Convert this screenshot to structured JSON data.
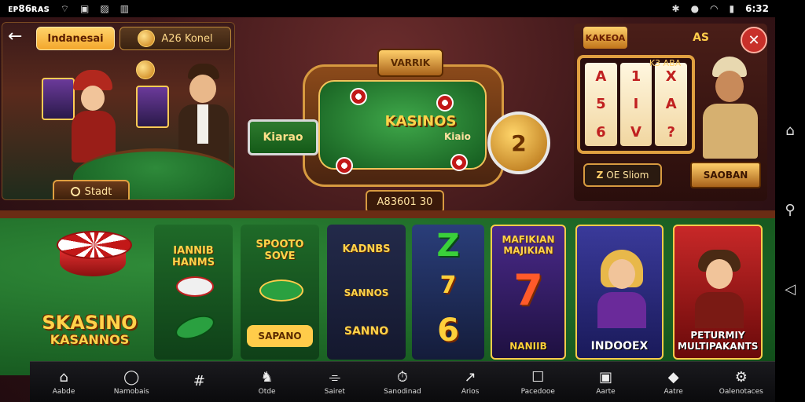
{
  "status": {
    "left_text": "ᴇᴘ86ʀᴀs",
    "time": "6:32"
  },
  "top_left": {
    "lang_label": "Indanesai",
    "pill2_label": "A26 Konel",
    "start_label": "Stadt"
  },
  "center": {
    "badge_top": "VARRIK",
    "badge_left": "Kiarao",
    "title": "KASINOS",
    "mini": "Kiaio",
    "coin_value": "2",
    "jackpot": "A83601 30"
  },
  "top_right": {
    "badge1": "KAKEOA",
    "badge2": "AS",
    "strip_text": "K3 ABA",
    "bet_label": "OE Sliom",
    "bet_icon": "Z",
    "spin_badge": "SAOBAN",
    "reels": [
      [
        "A",
        "5",
        "6"
      ],
      [
        "1",
        "I",
        "V"
      ],
      [
        "X",
        "A",
        "?"
      ]
    ]
  },
  "brand": {
    "line1": "SKASINO",
    "line2": "KASANNOS"
  },
  "tiles": [
    {
      "title": "IANNIB HANMS",
      "style": "green"
    },
    {
      "title": "SPOOTO SOVE",
      "style": "green"
    },
    {
      "title": "KADNBS",
      "subtitle1": "SANNOS",
      "subtitle2": "SANNO",
      "style": "navy"
    },
    {
      "num1": "Z",
      "num2": "7",
      "num3": "6",
      "style": "blue"
    },
    {
      "title": "MAFIKIAN MAJIKIAN",
      "num": "7",
      "label": "NANIIB",
      "style": "purple"
    },
    {
      "label": "INDOOEX",
      "style": "red-blue"
    },
    {
      "label": "PETURMIY MULTIPAKANTS",
      "style": "red"
    }
  ],
  "bottom_nav": [
    {
      "label": "Aabde",
      "icon": "⌂"
    },
    {
      "label": "Namobais",
      "icon": "◯"
    },
    {
      "label": "",
      "icon": "#"
    },
    {
      "label": "Otde",
      "icon": "♞"
    },
    {
      "label": "Sairet",
      "icon": "⌯"
    },
    {
      "label": "Sanodinad",
      "icon": "⏱"
    },
    {
      "label": "Arios",
      "icon": "↗"
    },
    {
      "label": "Pacedooe",
      "icon": "☐"
    },
    {
      "label": "Aarte",
      "icon": "▣"
    },
    {
      "label": "Aatre",
      "icon": "◆"
    },
    {
      "label": "Oalenotaces",
      "icon": "⚙"
    }
  ]
}
